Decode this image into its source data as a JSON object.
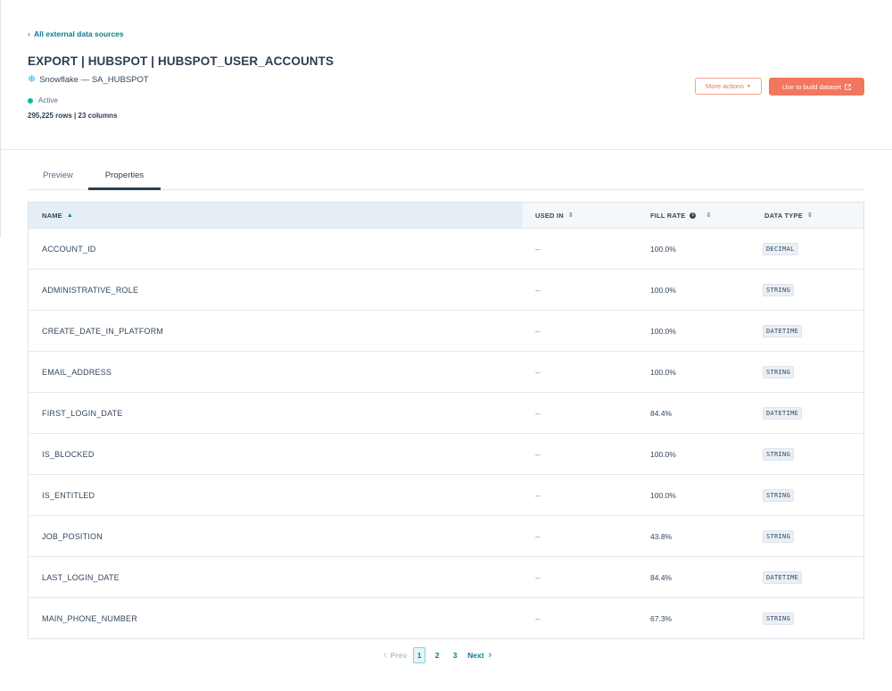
{
  "header": {
    "back_link": "All external data sources",
    "title": "EXPORT | HUBSPOT | HUBSPOT_USER_ACCOUNTS",
    "source": "Snowflake — SA_HUBSPOT",
    "status": "Active",
    "counts": "295,225 rows | 23 columns",
    "more_actions_label": "More actions",
    "build_label": "Use to build dataset"
  },
  "colors": {
    "accent_teal": "#0a7d8c",
    "primary_button": "#f2775e",
    "status_active": "#00bda5"
  },
  "tabs": [
    {
      "label": "Preview",
      "active": false
    },
    {
      "label": "Properties",
      "active": true
    }
  ],
  "table": {
    "columns": {
      "name": "NAME",
      "used_in": "USED IN",
      "fill_rate": "FILL RATE",
      "data_type": "DATA TYPE"
    },
    "rows": [
      {
        "name": "ACCOUNT_ID",
        "used_in": "--",
        "fill_rate": "100.0%",
        "data_type": "DECIMAL"
      },
      {
        "name": "ADMINISTRATIVE_ROLE",
        "used_in": "--",
        "fill_rate": "100.0%",
        "data_type": "STRING"
      },
      {
        "name": "CREATE_DATE_IN_PLATFORM",
        "used_in": "--",
        "fill_rate": "100.0%",
        "data_type": "DATETIME"
      },
      {
        "name": "EMAIL_ADDRESS",
        "used_in": "--",
        "fill_rate": "100.0%",
        "data_type": "STRING"
      },
      {
        "name": "FIRST_LOGIN_DATE",
        "used_in": "--",
        "fill_rate": "84.4%",
        "data_type": "DATETIME"
      },
      {
        "name": "IS_BLOCKED",
        "used_in": "--",
        "fill_rate": "100.0%",
        "data_type": "STRING"
      },
      {
        "name": "IS_ENTITLED",
        "used_in": "--",
        "fill_rate": "100.0%",
        "data_type": "STRING"
      },
      {
        "name": "JOB_POSITION",
        "used_in": "--",
        "fill_rate": "43.8%",
        "data_type": "STRING"
      },
      {
        "name": "LAST_LOGIN_DATE",
        "used_in": "--",
        "fill_rate": "84.4%",
        "data_type": "DATETIME"
      },
      {
        "name": "MAIN_PHONE_NUMBER",
        "used_in": "--",
        "fill_rate": "67.3%",
        "data_type": "STRING"
      }
    ]
  },
  "pagination": {
    "prev": "Prev",
    "pages": [
      "1",
      "2",
      "3"
    ],
    "current": "1",
    "next": "Next"
  }
}
